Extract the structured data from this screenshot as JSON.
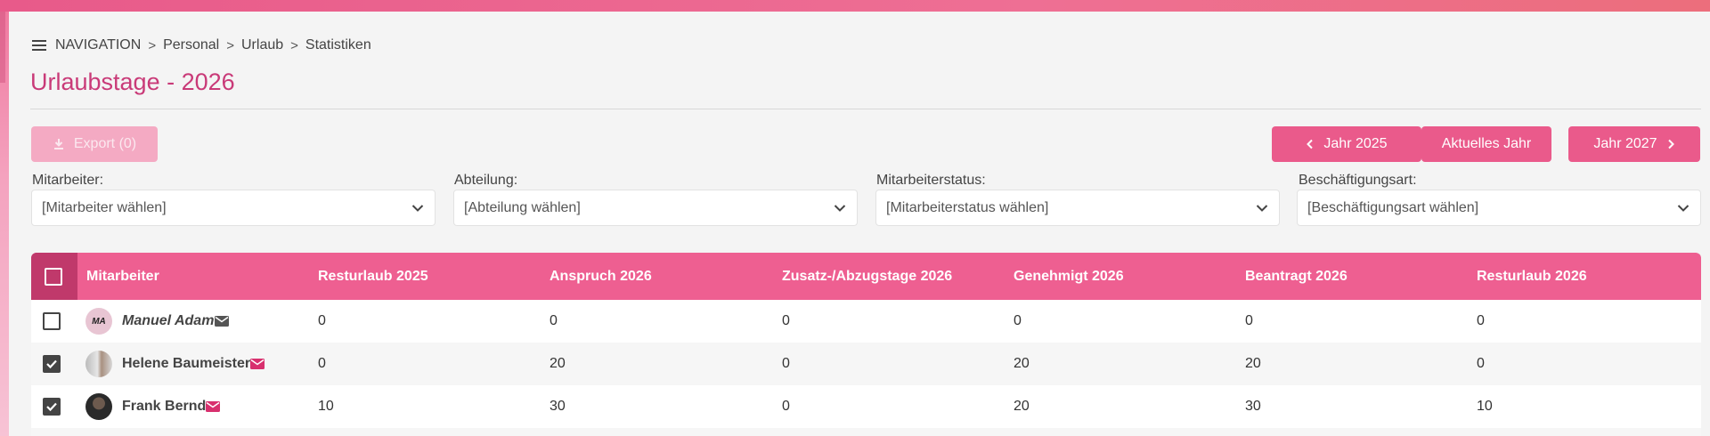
{
  "breadcrumb": {
    "nav": "NAVIGATION",
    "items": [
      "Personal",
      "Urlaub",
      "Statistiken"
    ]
  },
  "page_title": "Urlaubstage - 2026",
  "toolbar": {
    "export_label": "Export (0)",
    "prev_year_label": "Jahr 2025",
    "current_year_label": "Aktuelles Jahr",
    "next_year_label": "Jahr 2027"
  },
  "filters": [
    {
      "label": "Mitarbeiter:",
      "value": "[Mitarbeiter wählen]"
    },
    {
      "label": "Abteilung:",
      "value": "[Abteilung wählen]"
    },
    {
      "label": "Mitarbeiterstatus:",
      "value": "[Mitarbeiterstatus wählen]"
    },
    {
      "label": "Beschäftigungsart:",
      "value": "[Beschäftigungsart wählen]"
    }
  ],
  "table": {
    "headers": [
      "Mitarbeiter",
      "Resturlaub 2025",
      "Anspruch 2026",
      "Zusatz-/Abzugstage 2026",
      "Genehmigt 2026",
      "Beantragt 2026",
      "Resturlaub 2026"
    ],
    "rows": [
      {
        "initials": "MA",
        "name": "Manuel Adam",
        "checked": false,
        "values": [
          "0",
          "0",
          "0",
          "0",
          "0",
          "0"
        ]
      },
      {
        "initials": "",
        "name": "Helene Baumeister",
        "checked": true,
        "values": [
          "0",
          "20",
          "0",
          "20",
          "20",
          "0"
        ]
      },
      {
        "initials": "",
        "name": "Frank Bernd",
        "checked": true,
        "values": [
          "10",
          "30",
          "0",
          "20",
          "30",
          "10"
        ]
      }
    ]
  },
  "colors": {
    "accent": "#ea5a8b",
    "title": "#c93a78",
    "header_dark": "#c0396b"
  },
  "icons": [
    "menu-icon",
    "chevron-right-icon",
    "download-icon",
    "chevron-left-icon",
    "chevron-down-icon",
    "mail-icon",
    "check-icon"
  ]
}
